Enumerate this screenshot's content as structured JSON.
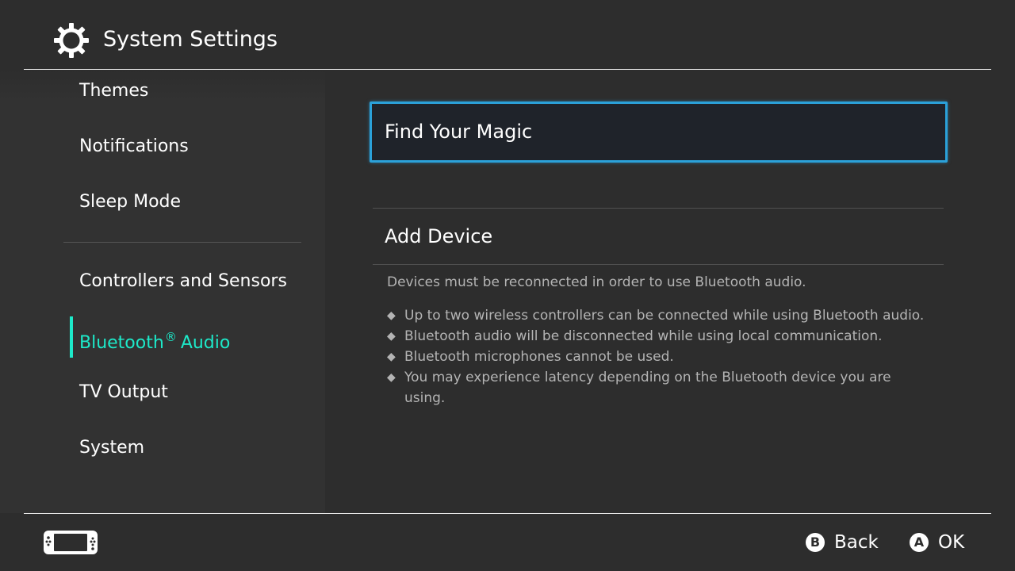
{
  "header": {
    "title": "System Settings",
    "icon": "gear-icon"
  },
  "sidebar": {
    "items": [
      {
        "label": "Themes",
        "selected": false
      },
      {
        "label": "Notifications",
        "selected": false
      },
      {
        "label": "Sleep Mode",
        "selected": false
      },
      {
        "label": "Controllers and Sensors",
        "selected": false
      },
      {
        "label_main": "Bluetooth",
        "label_mark": "®",
        "label_tail": "Audio",
        "selected": true
      },
      {
        "label": "TV Output",
        "selected": false
      },
      {
        "label": "System",
        "selected": false
      }
    ],
    "selected_color": "#1de9c9"
  },
  "main": {
    "device": {
      "label": "Find Your Magic",
      "focused": true
    },
    "add_device": {
      "label": "Add Device"
    },
    "info": {
      "intro": "Devices must be reconnected in order to use Bluetooth audio.",
      "bullet_glyph": "◆",
      "notes": [
        "Up to two wireless controllers can be connected while using Bluetooth audio.",
        "Bluetooth audio will be disconnected while using local communication.",
        "Bluetooth microphones cannot be used.",
        "You may experience latency depending on the Bluetooth device you are using."
      ]
    },
    "focus_color": "#2ba1d9"
  },
  "footer": {
    "console_icon": "console-icon",
    "buttons": [
      {
        "glyph": "B",
        "label": "Back"
      },
      {
        "glyph": "A",
        "label": "OK"
      }
    ]
  }
}
